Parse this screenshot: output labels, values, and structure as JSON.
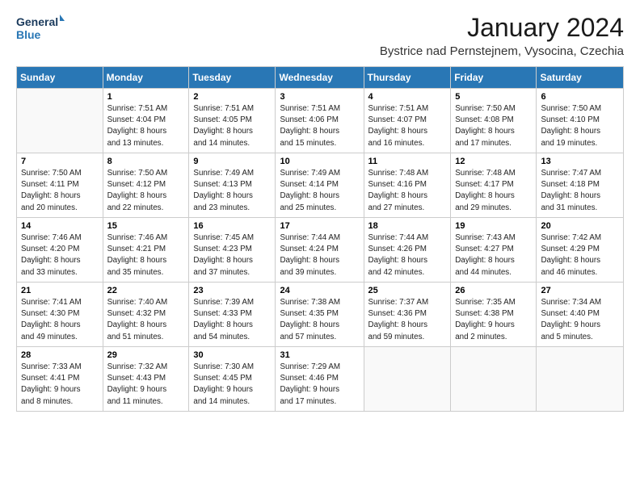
{
  "logo": {
    "line1": "General",
    "line2": "Blue"
  },
  "title": "January 2024",
  "subtitle": "Bystrice nad Pernstejnem, Vysocina, Czechia",
  "days_header": [
    "Sunday",
    "Monday",
    "Tuesday",
    "Wednesday",
    "Thursday",
    "Friday",
    "Saturday"
  ],
  "weeks": [
    [
      {
        "day": "",
        "info": ""
      },
      {
        "day": "1",
        "info": "Sunrise: 7:51 AM\nSunset: 4:04 PM\nDaylight: 8 hours\nand 13 minutes."
      },
      {
        "day": "2",
        "info": "Sunrise: 7:51 AM\nSunset: 4:05 PM\nDaylight: 8 hours\nand 14 minutes."
      },
      {
        "day": "3",
        "info": "Sunrise: 7:51 AM\nSunset: 4:06 PM\nDaylight: 8 hours\nand 15 minutes."
      },
      {
        "day": "4",
        "info": "Sunrise: 7:51 AM\nSunset: 4:07 PM\nDaylight: 8 hours\nand 16 minutes."
      },
      {
        "day": "5",
        "info": "Sunrise: 7:50 AM\nSunset: 4:08 PM\nDaylight: 8 hours\nand 17 minutes."
      },
      {
        "day": "6",
        "info": "Sunrise: 7:50 AM\nSunset: 4:10 PM\nDaylight: 8 hours\nand 19 minutes."
      }
    ],
    [
      {
        "day": "7",
        "info": "Sunrise: 7:50 AM\nSunset: 4:11 PM\nDaylight: 8 hours\nand 20 minutes."
      },
      {
        "day": "8",
        "info": "Sunrise: 7:50 AM\nSunset: 4:12 PM\nDaylight: 8 hours\nand 22 minutes."
      },
      {
        "day": "9",
        "info": "Sunrise: 7:49 AM\nSunset: 4:13 PM\nDaylight: 8 hours\nand 23 minutes."
      },
      {
        "day": "10",
        "info": "Sunrise: 7:49 AM\nSunset: 4:14 PM\nDaylight: 8 hours\nand 25 minutes."
      },
      {
        "day": "11",
        "info": "Sunrise: 7:48 AM\nSunset: 4:16 PM\nDaylight: 8 hours\nand 27 minutes."
      },
      {
        "day": "12",
        "info": "Sunrise: 7:48 AM\nSunset: 4:17 PM\nDaylight: 8 hours\nand 29 minutes."
      },
      {
        "day": "13",
        "info": "Sunrise: 7:47 AM\nSunset: 4:18 PM\nDaylight: 8 hours\nand 31 minutes."
      }
    ],
    [
      {
        "day": "14",
        "info": "Sunrise: 7:46 AM\nSunset: 4:20 PM\nDaylight: 8 hours\nand 33 minutes."
      },
      {
        "day": "15",
        "info": "Sunrise: 7:46 AM\nSunset: 4:21 PM\nDaylight: 8 hours\nand 35 minutes."
      },
      {
        "day": "16",
        "info": "Sunrise: 7:45 AM\nSunset: 4:23 PM\nDaylight: 8 hours\nand 37 minutes."
      },
      {
        "day": "17",
        "info": "Sunrise: 7:44 AM\nSunset: 4:24 PM\nDaylight: 8 hours\nand 39 minutes."
      },
      {
        "day": "18",
        "info": "Sunrise: 7:44 AM\nSunset: 4:26 PM\nDaylight: 8 hours\nand 42 minutes."
      },
      {
        "day": "19",
        "info": "Sunrise: 7:43 AM\nSunset: 4:27 PM\nDaylight: 8 hours\nand 44 minutes."
      },
      {
        "day": "20",
        "info": "Sunrise: 7:42 AM\nSunset: 4:29 PM\nDaylight: 8 hours\nand 46 minutes."
      }
    ],
    [
      {
        "day": "21",
        "info": "Sunrise: 7:41 AM\nSunset: 4:30 PM\nDaylight: 8 hours\nand 49 minutes."
      },
      {
        "day": "22",
        "info": "Sunrise: 7:40 AM\nSunset: 4:32 PM\nDaylight: 8 hours\nand 51 minutes."
      },
      {
        "day": "23",
        "info": "Sunrise: 7:39 AM\nSunset: 4:33 PM\nDaylight: 8 hours\nand 54 minutes."
      },
      {
        "day": "24",
        "info": "Sunrise: 7:38 AM\nSunset: 4:35 PM\nDaylight: 8 hours\nand 57 minutes."
      },
      {
        "day": "25",
        "info": "Sunrise: 7:37 AM\nSunset: 4:36 PM\nDaylight: 8 hours\nand 59 minutes."
      },
      {
        "day": "26",
        "info": "Sunrise: 7:35 AM\nSunset: 4:38 PM\nDaylight: 9 hours\nand 2 minutes."
      },
      {
        "day": "27",
        "info": "Sunrise: 7:34 AM\nSunset: 4:40 PM\nDaylight: 9 hours\nand 5 minutes."
      }
    ],
    [
      {
        "day": "28",
        "info": "Sunrise: 7:33 AM\nSunset: 4:41 PM\nDaylight: 9 hours\nand 8 minutes."
      },
      {
        "day": "29",
        "info": "Sunrise: 7:32 AM\nSunset: 4:43 PM\nDaylight: 9 hours\nand 11 minutes."
      },
      {
        "day": "30",
        "info": "Sunrise: 7:30 AM\nSunset: 4:45 PM\nDaylight: 9 hours\nand 14 minutes."
      },
      {
        "day": "31",
        "info": "Sunrise: 7:29 AM\nSunset: 4:46 PM\nDaylight: 9 hours\nand 17 minutes."
      },
      {
        "day": "",
        "info": ""
      },
      {
        "day": "",
        "info": ""
      },
      {
        "day": "",
        "info": ""
      }
    ]
  ]
}
